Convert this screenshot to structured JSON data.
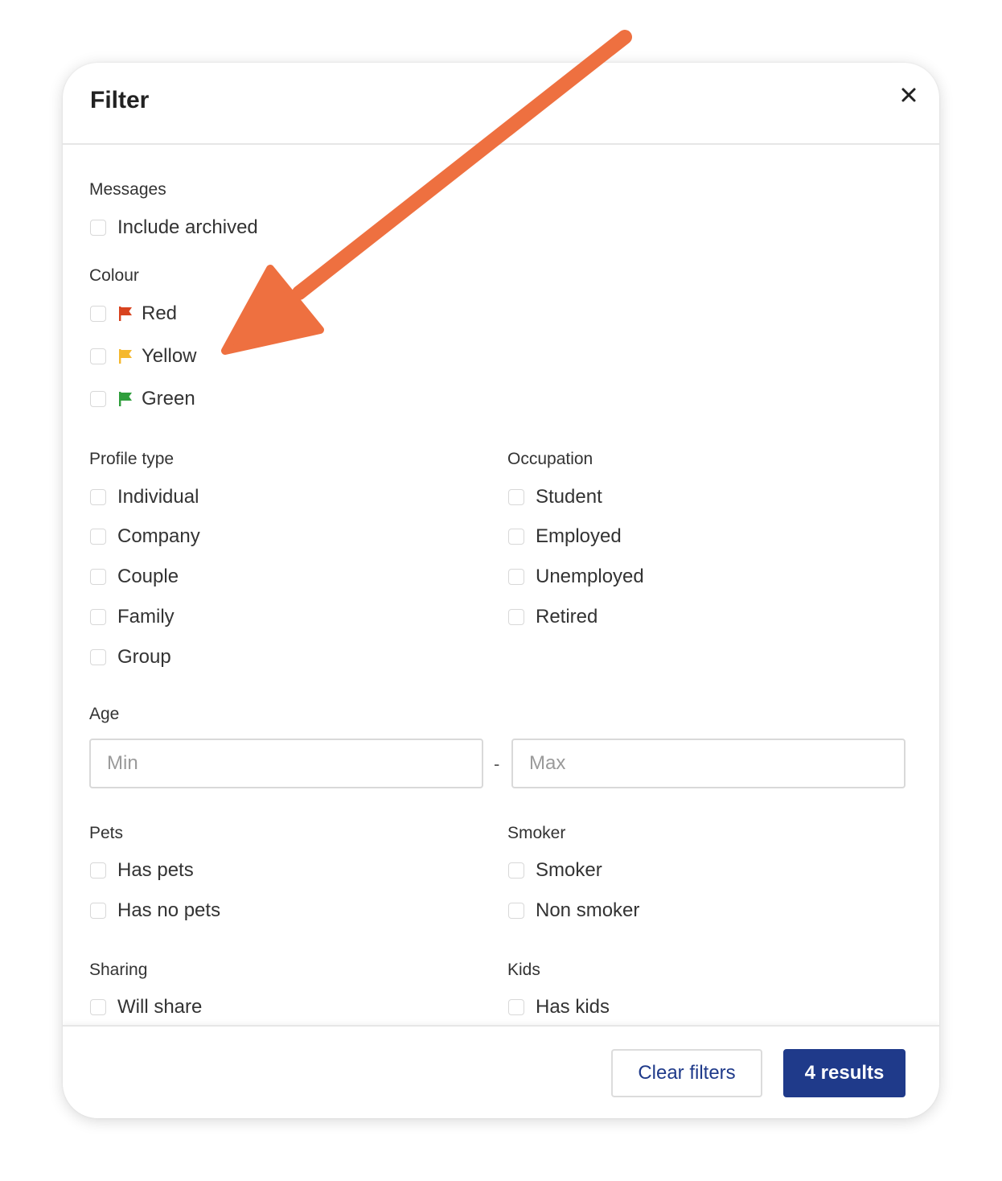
{
  "modal": {
    "title": "Filter"
  },
  "sections": {
    "messages": {
      "label": "Messages",
      "options": [
        "Include archived"
      ]
    },
    "colour": {
      "label": "Colour",
      "options": [
        {
          "label": "Red",
          "flag_color": "#d8431f"
        },
        {
          "label": "Yellow",
          "flag_color": "#f5b82e"
        },
        {
          "label": "Green",
          "flag_color": "#2f9e3c"
        }
      ]
    },
    "profile_type": {
      "label": "Profile type",
      "options": [
        "Individual",
        "Company",
        "Couple",
        "Family",
        "Group"
      ]
    },
    "occupation": {
      "label": "Occupation",
      "options": [
        "Student",
        "Employed",
        "Unemployed",
        "Retired"
      ]
    },
    "age": {
      "label": "Age",
      "min_placeholder": "Min",
      "max_placeholder": "Max",
      "separator": "-"
    },
    "pets": {
      "label": "Pets",
      "options": [
        "Has pets",
        "Has no pets"
      ]
    },
    "smoker": {
      "label": "Smoker",
      "options": [
        "Smoker",
        "Non smoker"
      ]
    },
    "sharing": {
      "label": "Sharing",
      "options": [
        "Will share"
      ]
    },
    "kids": {
      "label": "Kids",
      "options": [
        "Has kids"
      ]
    }
  },
  "footer": {
    "clear_label": "Clear filters",
    "results_label": "4 results"
  },
  "colors": {
    "primary": "#1f3a8a",
    "annotation_arrow": "#ee7040"
  }
}
